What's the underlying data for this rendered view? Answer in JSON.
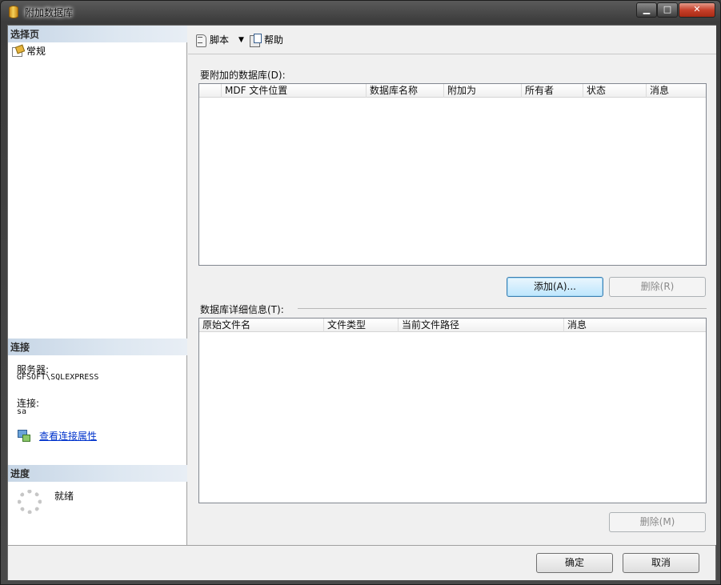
{
  "window": {
    "title": "附加数据库"
  },
  "left": {
    "select_page_header": "选择页",
    "nav_items": [
      {
        "label": "常规",
        "icon": "page-icon"
      }
    ],
    "connection_header": "连接",
    "server_label": "服务器:",
    "server_value": "GFSOFT\\SQLEXPRESS",
    "connection_label": "连接:",
    "connection_value": "sa",
    "view_props_link": "查看连接属性",
    "progress_header": "进度",
    "progress_status": "就绪"
  },
  "toolbar": {
    "script_label": "脚本",
    "help_label": "帮助"
  },
  "attach": {
    "label": "要附加的数据库(D):",
    "columns": [
      "",
      "MDF 文件位置",
      "数据库名称",
      "附加为",
      "所有者",
      "状态",
      "消息"
    ],
    "add_button": "添加(A)...",
    "remove_button": "删除(R)"
  },
  "details": {
    "label": "数据库详细信息(T):",
    "columns": [
      "原始文件名",
      "文件类型",
      "当前文件路径",
      "消息"
    ],
    "remove_button": "删除(M)"
  },
  "footer": {
    "ok_button": "确定",
    "cancel_button": "取消"
  },
  "colors": {
    "title_gradient_top": "#5a5a5a",
    "section_header": "#c7d6e6",
    "link": "#0033cc"
  }
}
